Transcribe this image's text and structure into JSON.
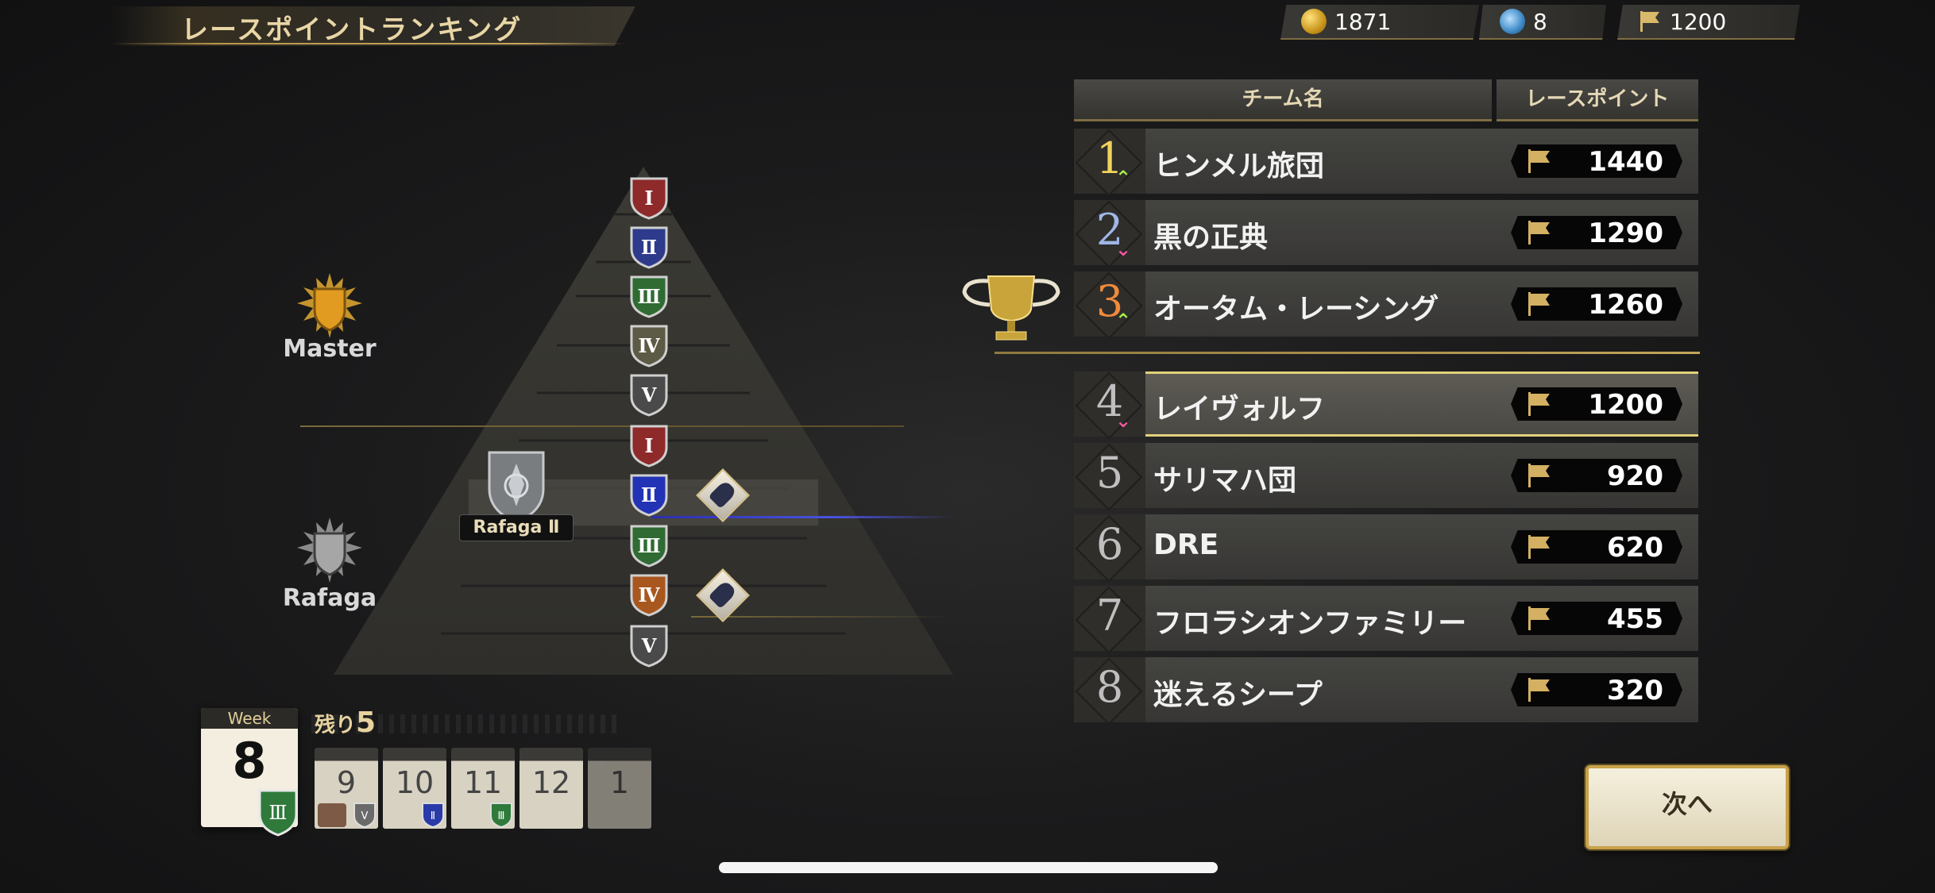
{
  "header": {
    "title": "レースポイントランキング",
    "gold": "1871",
    "gems": "8",
    "race_points": "1200"
  },
  "league": {
    "master_label": "Master",
    "rafaga_label": "Rafaga",
    "player_badge": "Rafaga Ⅱ",
    "tiers": [
      "Ⅰ",
      "Ⅱ",
      "Ⅲ",
      "Ⅳ",
      "Ⅴ",
      "Ⅰ",
      "Ⅱ",
      "Ⅲ",
      "Ⅳ",
      "Ⅴ"
    ],
    "tier_colors": [
      "#8e2a2a",
      "#2e3b8c",
      "#2f6b32",
      "#5d5a45",
      "#4a4a4a",
      "#8e2a2a",
      "#2333b5",
      "#2f6b32",
      "#a8571f",
      "#4a4a4a"
    ]
  },
  "week": {
    "header": "Week",
    "number": "8",
    "remaining_label": "残り",
    "remaining_count": "5",
    "upcoming": [
      "9",
      "10",
      "11",
      "12",
      "1"
    ]
  },
  "table": {
    "col_team": "チーム名",
    "col_points": "レースポイント",
    "rows": [
      {
        "rank": "1",
        "name": "ヒンメル旅団",
        "points": "1440",
        "trend": "up"
      },
      {
        "rank": "2",
        "name": "黒の正典",
        "points": "1290",
        "trend": "down"
      },
      {
        "rank": "3",
        "name": "オータム・レーシング",
        "points": "1260",
        "trend": "up"
      },
      {
        "rank": "4",
        "name": "レイヴォルフ",
        "points": "1200",
        "trend": "down"
      },
      {
        "rank": "5",
        "name": "サリマハ団",
        "points": "920",
        "trend": ""
      },
      {
        "rank": "6",
        "name": "DRE",
        "points": "620",
        "trend": ""
      },
      {
        "rank": "7",
        "name": "フロラシオンファミリー",
        "points": "455",
        "trend": ""
      },
      {
        "rank": "8",
        "name": "迷えるシープ",
        "points": "320",
        "trend": ""
      }
    ]
  },
  "buttons": {
    "next": "次へ"
  }
}
